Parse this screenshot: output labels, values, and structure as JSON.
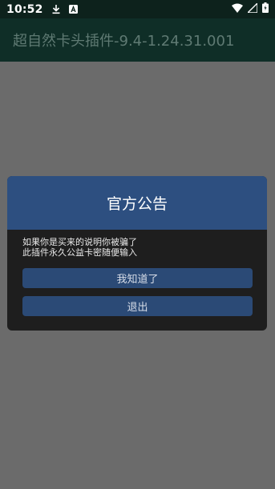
{
  "status_bar": {
    "time": "10:52",
    "icons": [
      "download-icon",
      "font-a-icon",
      "wifi-icon",
      "signal-icon",
      "battery-icon"
    ]
  },
  "app_bar": {
    "title": "超自然卡头插件-9.4-1.24.31.001"
  },
  "dialog": {
    "title": "官方公告",
    "message_line1": "如果你是买来的说明你被骗了",
    "message_line2": "此插件永久公益卡密随便输入",
    "button_confirm": "我知道了",
    "button_exit": "退出"
  },
  "colors": {
    "status_bar_bg": "#0d221c",
    "app_bar_bg": "#0f2e27",
    "overlay_bg": "#6b6b6b",
    "dialog_header_bg": "#2d4f80",
    "dialog_body_bg": "#1e1e1e",
    "button_bg": "#2b4a76"
  }
}
